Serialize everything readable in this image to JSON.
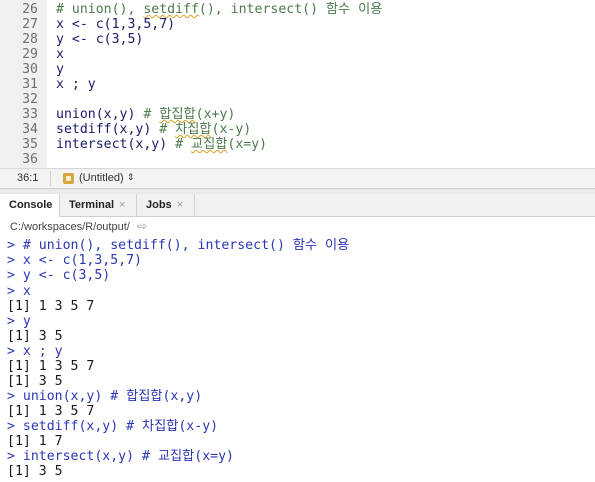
{
  "editor": {
    "lines": [
      {
        "num": "26",
        "text": "# union(), setdiff(), intersect() 함수 이용",
        "kind": "comment"
      },
      {
        "num": "27",
        "text": "x <- c(1,3,5,7)",
        "kind": "code"
      },
      {
        "num": "28",
        "text": "y <- c(3,5)",
        "kind": "code"
      },
      {
        "num": "29",
        "text": "x",
        "kind": "code"
      },
      {
        "num": "30",
        "text": "y",
        "kind": "code"
      },
      {
        "num": "31",
        "text": "x ; y",
        "kind": "code"
      },
      {
        "num": "32",
        "text": "",
        "kind": "code"
      },
      {
        "num": "33",
        "text": "union(x,y) # 합집합(x+y)",
        "kind": "mixed",
        "code": "union(x,y) ",
        "comment": "# 합집합(x+y)"
      },
      {
        "num": "34",
        "text": "setdiff(x,y) # 차집합(x-y)",
        "kind": "mixed",
        "code": "setdiff(x,y) ",
        "comment": "# 차집합(x-y)"
      },
      {
        "num": "35",
        "text": "intersect(x,y) # 교집합(x=y)",
        "kind": "mixed",
        "code": "intersect(x,y) ",
        "comment": "# 교집합(x=y)"
      },
      {
        "num": "36",
        "text": "",
        "kind": "code"
      }
    ]
  },
  "status": {
    "position": "36:1",
    "filetype": "(Untitled)",
    "filetype_arrow": "⇕"
  },
  "tabs": [
    {
      "label": "Console",
      "active": true,
      "closable": false
    },
    {
      "label": "Terminal",
      "active": false,
      "closable": true
    },
    {
      "label": "Jobs",
      "active": false,
      "closable": true
    }
  ],
  "close_glyph": "×",
  "path": {
    "text": "C:/workspaces/R/output/",
    "arrow": "⇨"
  },
  "console": {
    "lines": [
      {
        "text": "> # union(), setdiff(), intersect() 함수 이용",
        "kind": "prompt"
      },
      {
        "text": "> x <- c(1,3,5,7)",
        "kind": "prompt"
      },
      {
        "text": "> y <- c(3,5)",
        "kind": "prompt"
      },
      {
        "text": "> x",
        "kind": "prompt"
      },
      {
        "text": "[1] 1 3 5 7",
        "kind": "output"
      },
      {
        "text": "> y",
        "kind": "prompt"
      },
      {
        "text": "[1] 3 5",
        "kind": "output"
      },
      {
        "text": "> x ; y",
        "kind": "prompt"
      },
      {
        "text": "[1] 1 3 5 7",
        "kind": "output"
      },
      {
        "text": "[1] 3 5",
        "kind": "output"
      },
      {
        "text": "> union(x,y) # 합집합(x,y)",
        "kind": "prompt"
      },
      {
        "text": "[1] 1 3 5 7",
        "kind": "output"
      },
      {
        "text": "> setdiff(x,y) # 차집합(x-y)",
        "kind": "prompt"
      },
      {
        "text": "[1] 1 7",
        "kind": "output"
      },
      {
        "text": "> intersect(x,y) # 교집합(x=y)",
        "kind": "prompt"
      },
      {
        "text": "[1] 3 5",
        "kind": "output"
      }
    ]
  }
}
